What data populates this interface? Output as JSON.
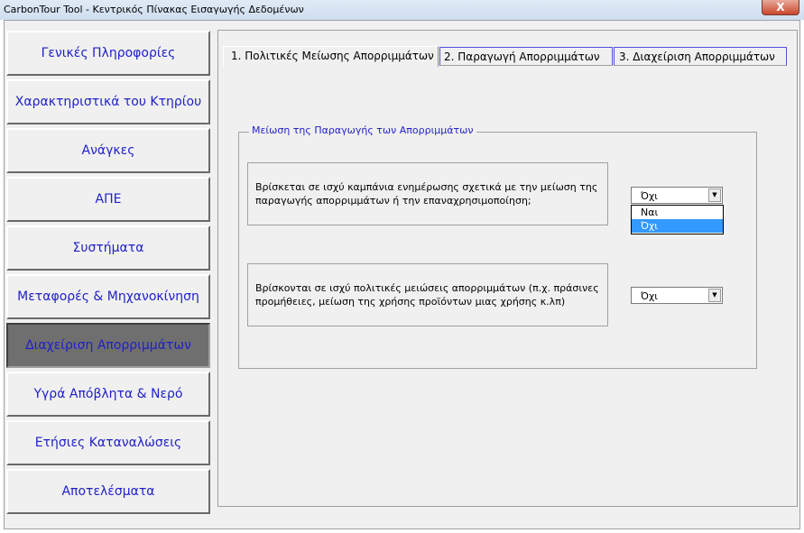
{
  "window": {
    "title": "CarbonTour Tool - Κεντρικός Πίνακας Εισαγωγής Δεδομένων",
    "close_label": "X"
  },
  "nav": {
    "items": [
      {
        "label": "Γενικές Πληροφορίες",
        "active": false
      },
      {
        "label": "Χαρακτηριστικά του Κτηρίου",
        "active": false
      },
      {
        "label": "Ανάγκες",
        "active": false
      },
      {
        "label": "ΑΠΕ",
        "active": false
      },
      {
        "label": "Συστήματα",
        "active": false
      },
      {
        "label": "Μεταφορές & Μηχανοκίνηση",
        "active": false
      },
      {
        "label": "Διαχείριση Απορριμμάτων",
        "active": true
      },
      {
        "label": "Υγρά Απόβλητα & Νερό",
        "active": false
      },
      {
        "label": "Ετήσιες Καταναλώσεις",
        "active": false
      },
      {
        "label": "Αποτελέσματα",
        "active": false
      }
    ]
  },
  "tabs": [
    {
      "label": "1.  Πολιτικές Μείωσης Απορριμμάτων",
      "selected": true
    },
    {
      "label": "2.  Παραγωγή Απορριμμάτων",
      "selected": false
    },
    {
      "label": "3.  Διαχείριση Απορριμμάτων",
      "selected": false
    }
  ],
  "section": {
    "title": "Μείωση της Παραγωγής των Απορριμμάτων",
    "questions": [
      {
        "text": "Βρίσκεται σε ισχύ καμπάνια ενημέρωσης σχετικά με την μείωση της παραγωγής απορριμμάτων ή την επαναχρησιμοποίηση;",
        "value": "Όχι",
        "open": true,
        "options": [
          "Ναι",
          "Όχι"
        ],
        "highlighted": "Όχι"
      },
      {
        "text": "Βρίσκονται σε ισχύ πολιτικές μειώσεις απορριμμάτων (π.χ. πράσινες προμήθειες, μείωση της χρήσης προϊόντων μιας χρήσης κ.λπ)",
        "value": "Όχι",
        "open": false
      }
    ]
  },
  "colors": {
    "nav_text": "#1f1fc8",
    "active_nav_bg": "#6f6f6f",
    "highlight": "#3399ff",
    "tab_border": "#5050e0"
  }
}
